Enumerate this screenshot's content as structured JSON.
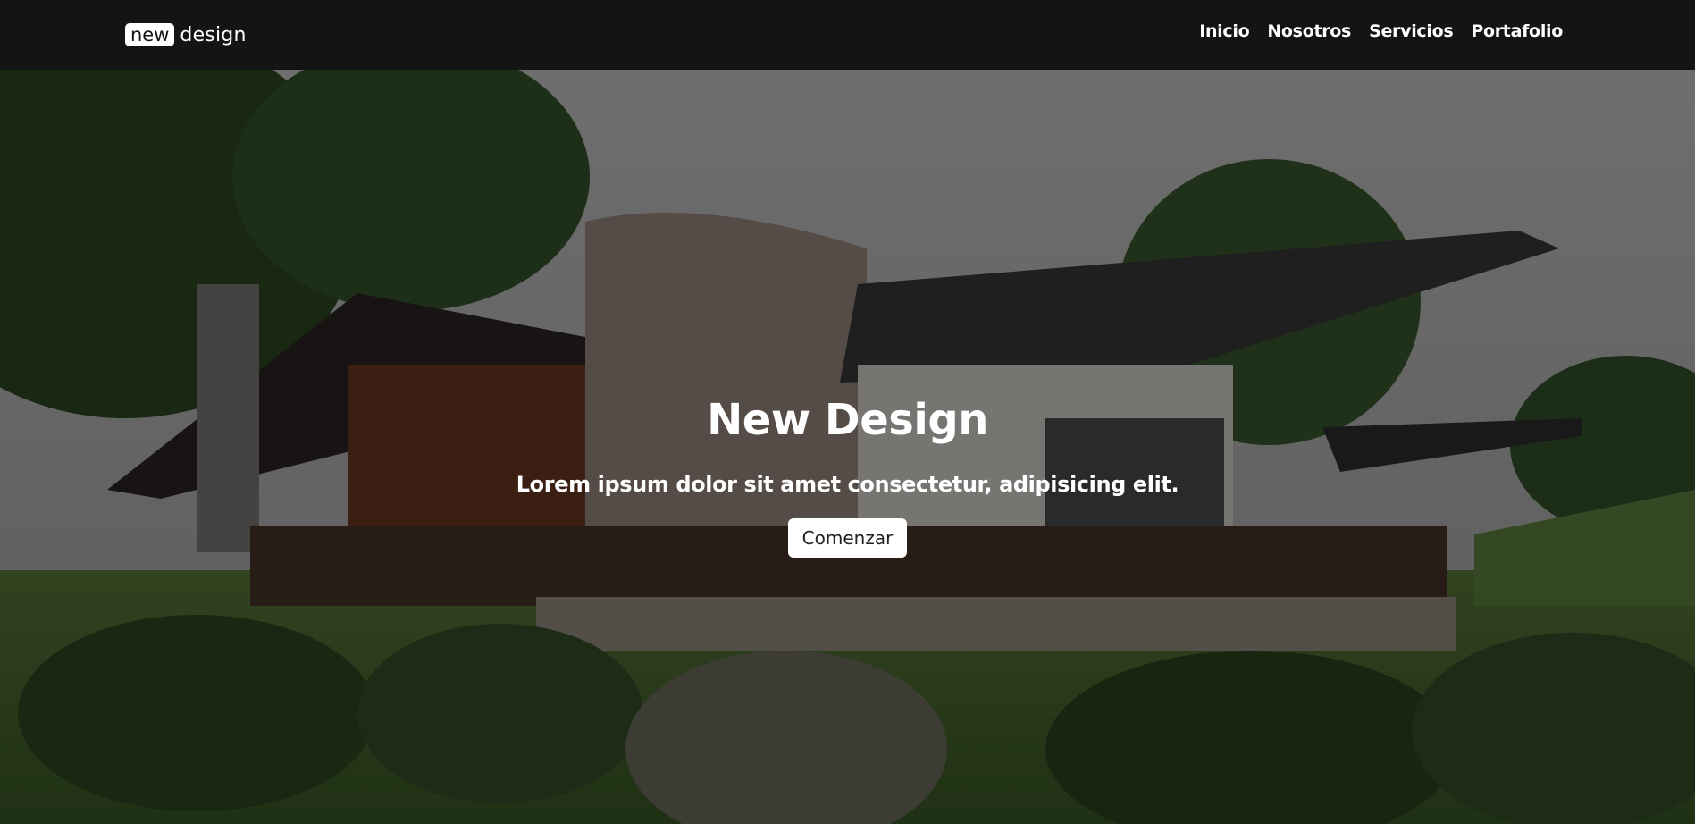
{
  "brand": {
    "badge": "new",
    "word": "design"
  },
  "nav": {
    "items": [
      {
        "label": "Inicio"
      },
      {
        "label": "Nosotros"
      },
      {
        "label": "Servicios"
      },
      {
        "label": "Portafolio"
      }
    ]
  },
  "hero": {
    "title": "New Design",
    "subtitle": "Lorem ipsum dolor sit amet consectetur, adipisicing elit.",
    "button_label": "Comenzar"
  },
  "colors": {
    "navbar_bg": "#141414",
    "text": "#ffffff",
    "button_bg": "#ffffff"
  }
}
